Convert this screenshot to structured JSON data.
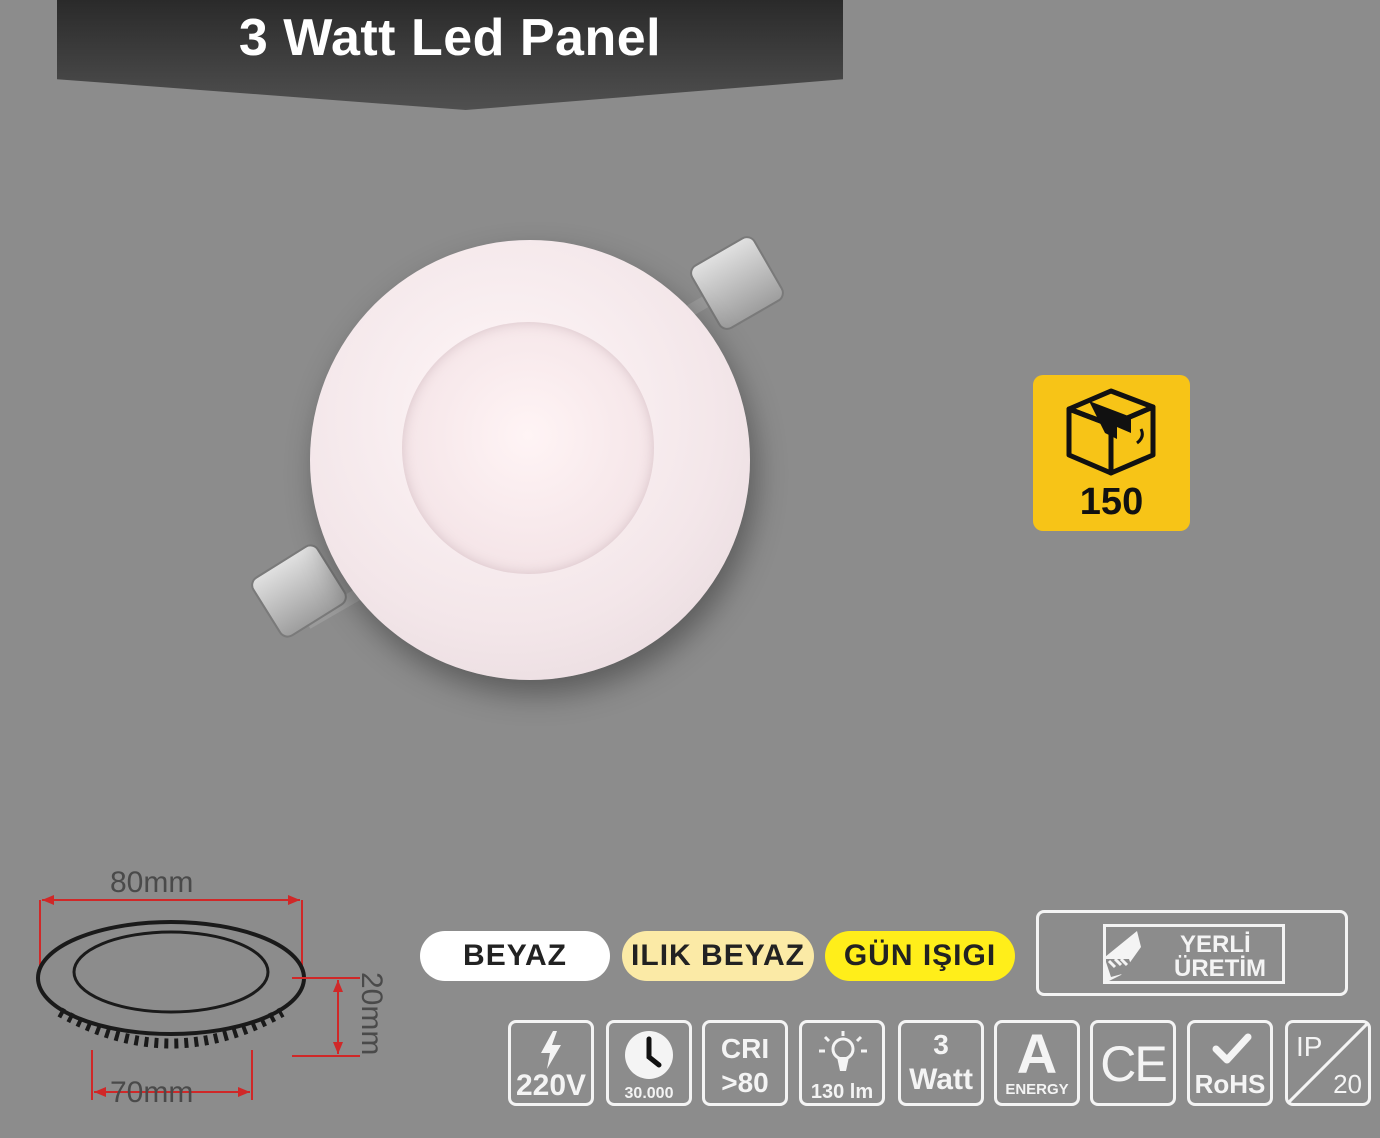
{
  "title": "3 Watt Led Panel",
  "package": {
    "icon": "box-icon",
    "count": "150"
  },
  "dimensions": {
    "top": "80mm",
    "bottom": "70mm",
    "side": "20mm"
  },
  "color_options": [
    "BEYAZ",
    "ILIK BEYAZ",
    "GÜN IŞIGI"
  ],
  "colors": {
    "white": "#ffffff",
    "warm_white": "#fbeaa6",
    "daylight": "#ffee1a",
    "package_badge": "#f7c417",
    "banner": "#333333"
  },
  "origin": {
    "line1": "YERLİ",
    "line2": "ÜRETİM"
  },
  "specs": {
    "voltage": {
      "icon": "lightning-icon",
      "label": "220V"
    },
    "lifetime": {
      "icon": "clock-icon",
      "label": "30.000"
    },
    "cri": {
      "line1": "CRI",
      "line2": ">80"
    },
    "lumen": {
      "icon": "bulb-icon",
      "label": "130 lm"
    },
    "power": {
      "line1": "3",
      "line2": "Watt"
    },
    "energy": {
      "line1": "A",
      "line2": "ENERGY"
    },
    "ce": {
      "label": "CE"
    },
    "rohs": {
      "icon": "check-icon",
      "label": "RoHS"
    },
    "ip": {
      "line1": "IP",
      "line2": "20"
    }
  }
}
